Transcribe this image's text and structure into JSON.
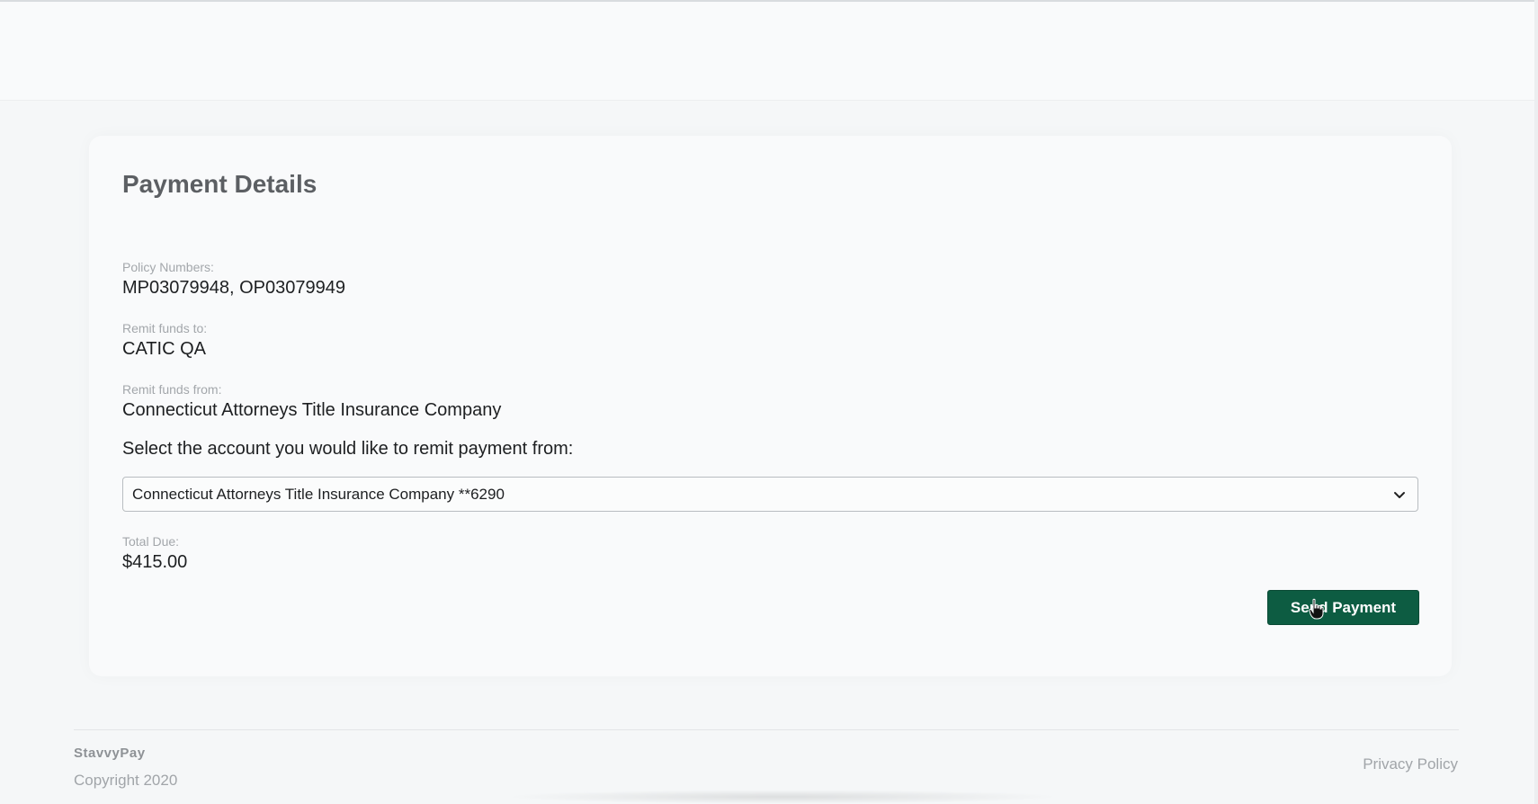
{
  "card": {
    "title": "Payment Details",
    "policy_label": "Policy Numbers:",
    "policy_value": "MP03079948, OP03079949",
    "remit_to_label": "Remit funds to:",
    "remit_to_value": "CATIC QA",
    "remit_from_label": "Remit funds from:",
    "remit_from_value": "Connecticut Attorneys Title Insurance Company",
    "select_prompt": "Select the account you would like to remit payment from:",
    "account_selected": "Connecticut Attorneys Title Insurance Company **6290",
    "total_label": "Total Due:",
    "total_value": "$415.00",
    "send_button_label": "Send Payment"
  },
  "footer": {
    "brand": "StavvyPay",
    "copyright": "Copyright 2020",
    "privacy_link": "Privacy Policy"
  },
  "colors": {
    "accent_button": "#0d5c42",
    "page_background": "#f5f7f8"
  },
  "icons": {
    "select_chevron": "chevron-down-icon",
    "cursor": "hand-pointer-icon"
  }
}
